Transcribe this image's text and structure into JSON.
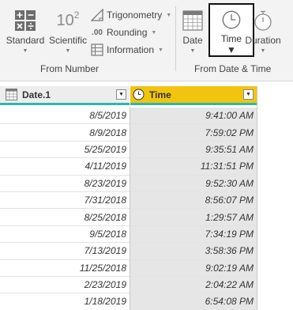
{
  "ribbon": {
    "from_number": {
      "group_label": "From Number",
      "standard_label": "Standard",
      "scientific_label": "Scientific",
      "scientific_icon_text": "10",
      "scientific_icon_sup": "2",
      "trigonometry_label": "Trigonometry",
      "rounding_label": "Rounding",
      "rounding_icon_text": ".00",
      "information_label": "Information"
    },
    "from_date_time": {
      "group_label": "From Date & Time",
      "date_label": "Date",
      "time_label": "Time",
      "duration_label": "Duration"
    }
  },
  "grid": {
    "columns": [
      {
        "name": "Date.1",
        "icon": "calendar-icon"
      },
      {
        "name": "Time",
        "icon": "clock-icon"
      }
    ],
    "rows": [
      {
        "date": "8/5/2019",
        "time": "9:41:00 AM"
      },
      {
        "date": "8/9/2018",
        "time": "7:59:02 PM"
      },
      {
        "date": "5/25/2019",
        "time": "9:35:51 AM"
      },
      {
        "date": "4/11/2019",
        "time": "11:31:51 PM"
      },
      {
        "date": "8/23/2019",
        "time": "9:52:30 AM"
      },
      {
        "date": "7/31/2018",
        "time": "8:56:07 PM"
      },
      {
        "date": "8/25/2018",
        "time": "1:29:57 AM"
      },
      {
        "date": "9/5/2018",
        "time": "7:34:19 PM"
      },
      {
        "date": "7/13/2019",
        "time": "3:58:36 PM"
      },
      {
        "date": "11/25/2018",
        "time": "9:02:19 AM"
      },
      {
        "date": "2/23/2019",
        "time": "2:04:22 AM"
      },
      {
        "date": "1/18/2019",
        "time": "6:54:08 PM"
      }
    ]
  },
  "colors": {
    "time_header": "#f1c40f",
    "header_underline": "#2ab9a9",
    "time_column_bg": "#e6e6e6"
  }
}
